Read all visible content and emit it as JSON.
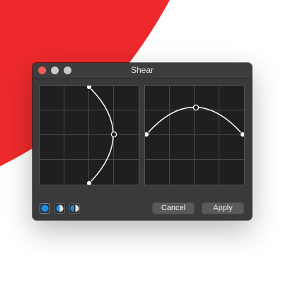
{
  "window": {
    "title": "Shear"
  },
  "colors": {
    "background_accent": "#ee2a2c",
    "window_bg": "#3a3a3c",
    "panel_bg": "#1f1f21",
    "grid_line": "#4a4a4d",
    "curve": "#ffffff",
    "traffic_close": "#ed5f57",
    "traffic_min": "#c9c9c9",
    "traffic_max": "#c9c9c9",
    "mode_active": "#1e90e6"
  },
  "traffic_lights": {
    "close": "close-button",
    "minimize": "minimize-button",
    "maximize": "maximize-button"
  },
  "mode_buttons": [
    {
      "icon": "circle-filled-icon",
      "active": true
    },
    {
      "icon": "circle-half-icon",
      "active": false
    },
    {
      "icon": "circle-split-icon",
      "active": false
    }
  ],
  "buttons": {
    "cancel": "Cancel",
    "apply": "Apply"
  }
}
